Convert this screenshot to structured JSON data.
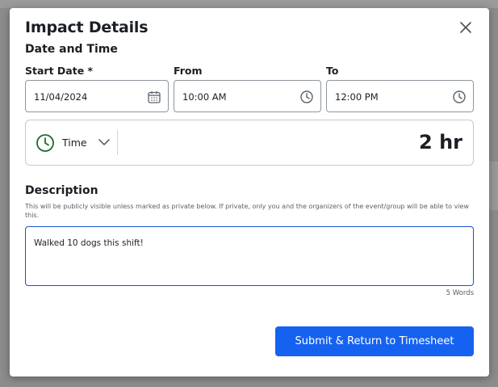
{
  "modal": {
    "title": "Impact Details",
    "section_title": "Date and Time"
  },
  "start_date": {
    "label": "Start Date *",
    "value": "11/04/2024",
    "icon": "calendar-icon"
  },
  "from": {
    "label": "From",
    "value": "10:00 AM",
    "icon": "clock-icon"
  },
  "to": {
    "label": "To",
    "value": "12:00 PM",
    "icon": "clock-icon"
  },
  "duration": {
    "unit": "Time",
    "value": "2 hr",
    "icon": "clock-icon",
    "accent": "#1e6b2b"
  },
  "description": {
    "title": "Description",
    "help": "This will be publicly visible unless marked as private below. If private, only you and the organizers of the event/group will be able to view this.",
    "value": "Walked 10 dogs this shift!",
    "word_count": "5 Words"
  },
  "submit_label": "Submit & Return to Timesheet",
  "colors": {
    "primary": "#1662f0",
    "focus_border": "#1a4fd6"
  }
}
